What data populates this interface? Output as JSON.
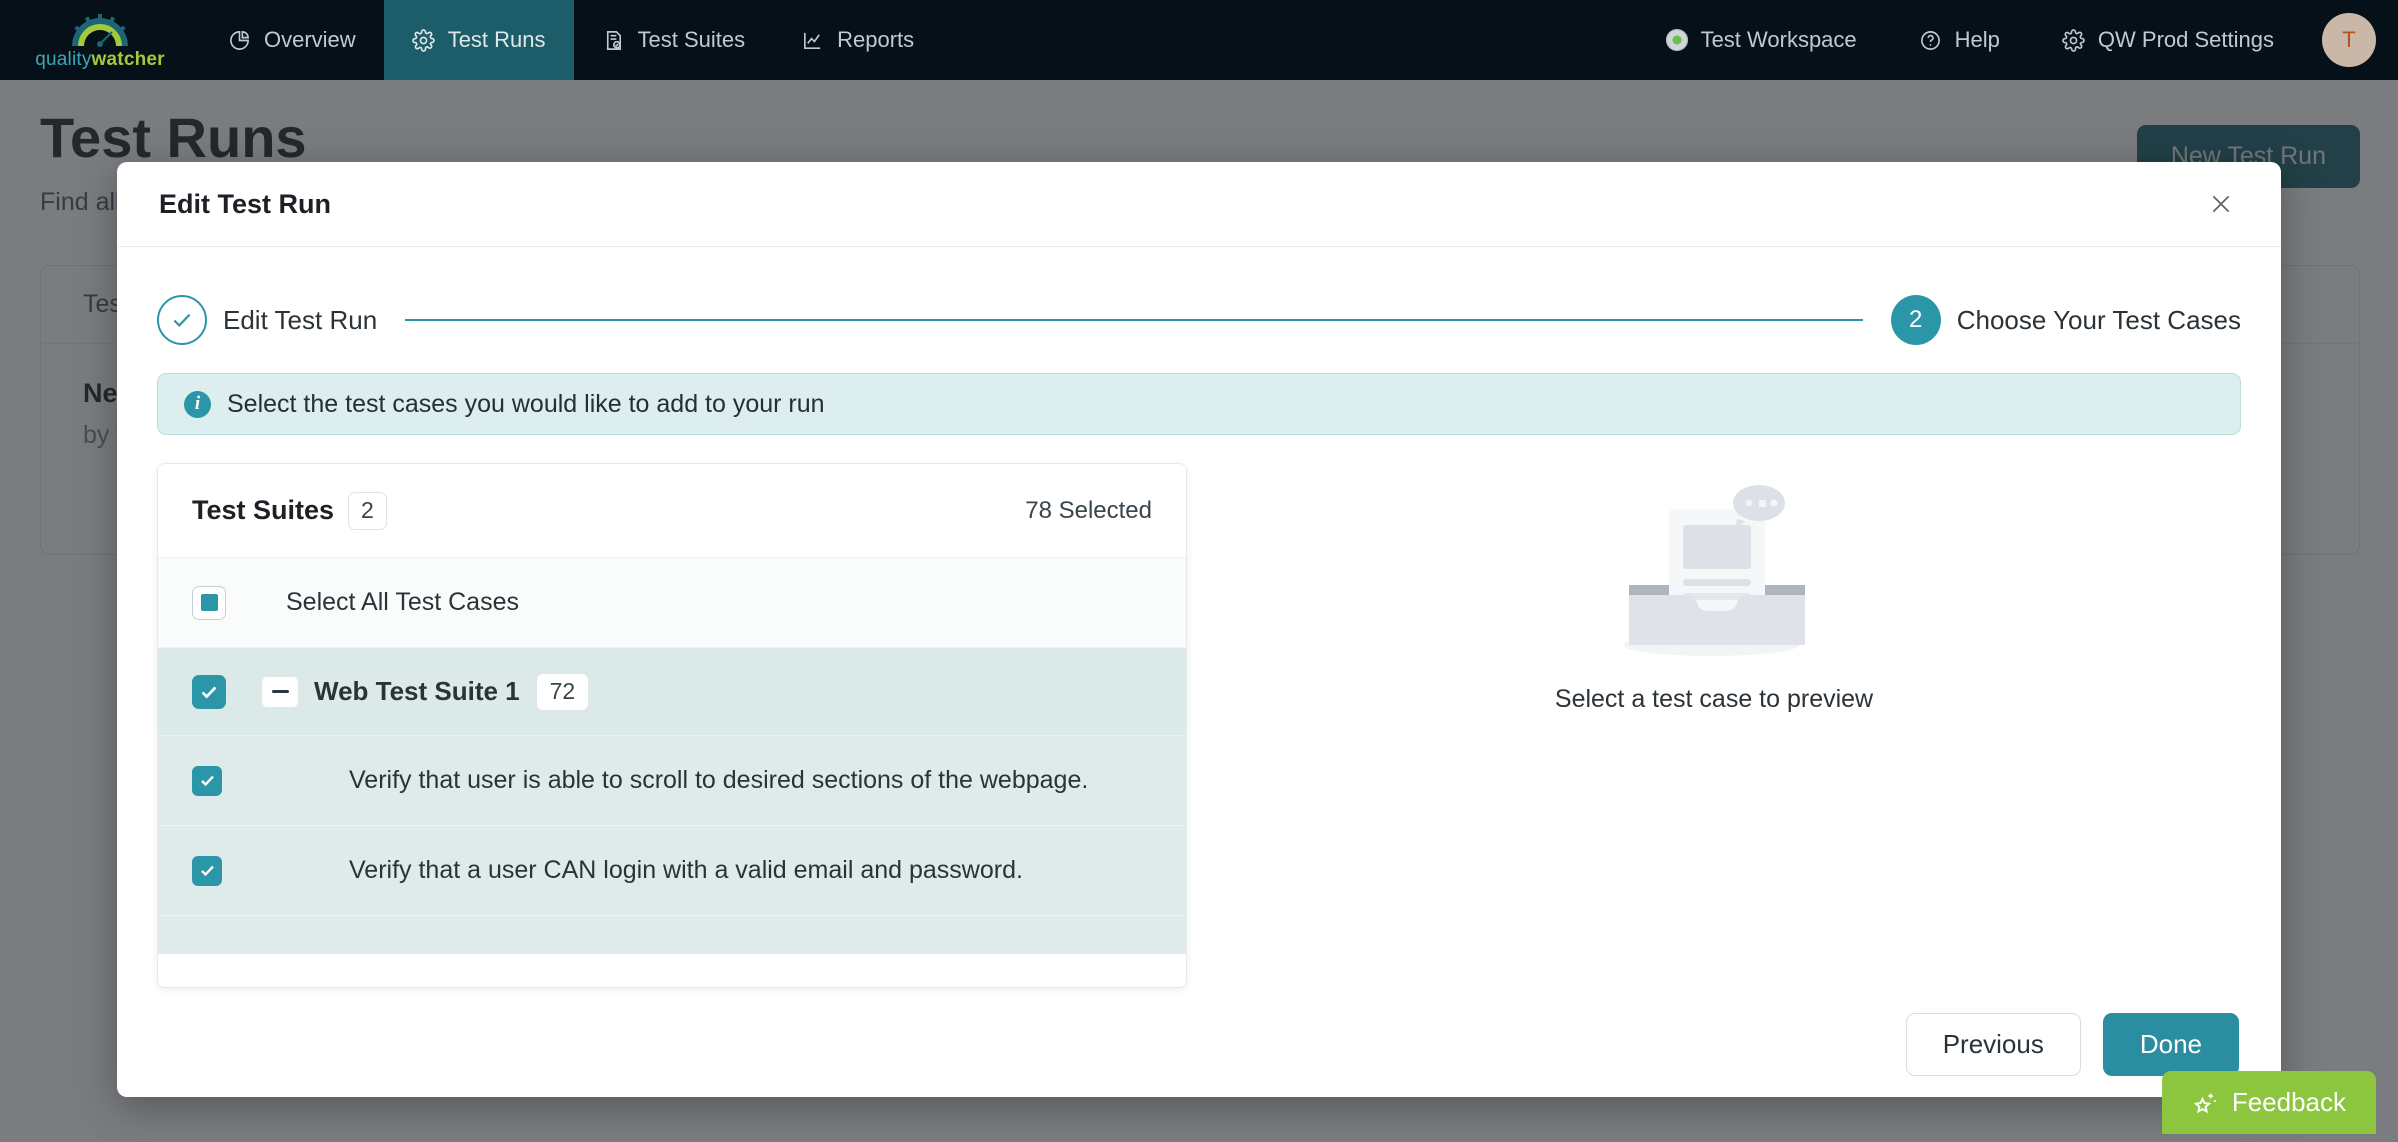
{
  "nav": {
    "logo": {
      "icon": "gauge-icon",
      "text_part1": "quality",
      "text_part2": "watcher"
    },
    "items": [
      {
        "label": "Overview",
        "icon": "pie-chart-icon",
        "active": false
      },
      {
        "label": "Test Runs",
        "icon": "gear-icon",
        "active": true
      },
      {
        "label": "Test Suites",
        "icon": "document-check-icon",
        "active": false
      },
      {
        "label": "Reports",
        "icon": "line-chart-icon",
        "active": false
      }
    ],
    "right": [
      {
        "label": "Test Workspace",
        "icon": "workspace-dot-icon"
      },
      {
        "label": "Help",
        "icon": "question-circle-icon"
      },
      {
        "label": "QW Prod Settings",
        "icon": "gear-icon"
      }
    ],
    "avatar_initial": "T"
  },
  "page": {
    "title": "Test Runs",
    "subtitle": "Find all your test runs here",
    "run_button": "New Test Run",
    "card": {
      "head": "Test Runs",
      "row_name": "New Test Run",
      "row_meta": "by Test User"
    }
  },
  "modal": {
    "title": "Edit Test Run",
    "close_icon": "close-icon",
    "stepper": {
      "step1": {
        "label": "Edit Test Run",
        "icon": "check-icon",
        "state": "done"
      },
      "step2": {
        "label": "Choose Your Test Cases",
        "number": "2",
        "state": "current"
      }
    },
    "info_banner": {
      "icon": "info-icon",
      "text": "Select the test cases you would like to add to your run"
    },
    "suites_panel": {
      "title": "Test Suites",
      "count": "2",
      "selected_label": "78 Selected",
      "select_all_label": "Select All Test Cases",
      "select_all_state": "indeterminate",
      "suites": [
        {
          "name": "Web Test Suite 1",
          "count": "72",
          "checked": true,
          "collapse_icon": "minus-icon",
          "cases": [
            {
              "label": "Verify that user is able to scroll to desired sections of the webpage.",
              "checked": true
            },
            {
              "label": "Verify that a user CAN login with a valid email and password.",
              "checked": true
            }
          ]
        }
      ]
    },
    "preview": {
      "illustration": "empty-inbox-illustration",
      "text": "Select a test case to preview"
    },
    "footer": {
      "previous_label": "Previous",
      "done_label": "Done"
    }
  },
  "feedback": {
    "label": "Feedback",
    "icon": "sparkle-star-icon"
  },
  "colors": {
    "nav_bg": "#061018",
    "nav_active": "#1c5d69",
    "accent_teal": "#2b96a8",
    "primary_button": "#2b8ea0",
    "run_button": "#18636f",
    "banner_bg": "#dceeee",
    "row_selected_bg": "#dfebea",
    "feedback_green": "#8cc63f",
    "logo_green": "#a4c93a",
    "avatar_bg": "#c9b7a8"
  }
}
